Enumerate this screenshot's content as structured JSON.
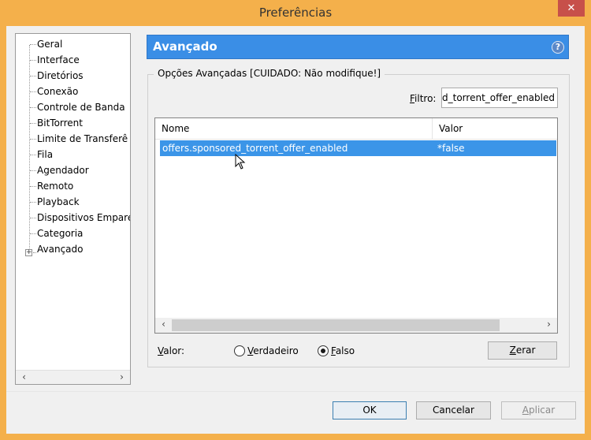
{
  "window": {
    "title": "Preferências",
    "close_symbol": "✕"
  },
  "tree": {
    "items": [
      "Geral",
      "Interface",
      "Diretórios",
      "Conexão",
      "Controle de Banda",
      "BitTorrent",
      "Limite de Transferê",
      "Fila",
      "Agendador",
      "Remoto",
      "Playback",
      "Dispositivos Empare",
      "Categoria",
      "Avançado"
    ],
    "expander_symbol": "+",
    "scroll_left": "‹",
    "scroll_right": "›"
  },
  "panel": {
    "title": "Avançado",
    "help_symbol": "?"
  },
  "group": {
    "title": "Opções Avançadas [CUIDADO: Não modifique!]"
  },
  "filter": {
    "label_prefix": "F",
    "label_rest": "iltro:",
    "value": "offers.sponsored_torrent_offer_enabled"
  },
  "list": {
    "columns": [
      "Nome",
      "Valor"
    ],
    "rows": [
      {
        "name": "offers.sponsored_torrent_offer_enabled",
        "value": "*false"
      }
    ],
    "scroll_left": "‹",
    "scroll_right": "›"
  },
  "value_editor": {
    "label_prefix": "V",
    "label_rest": "alor:",
    "options": [
      {
        "prefix": "V",
        "rest": "erdadeiro",
        "selected": false
      },
      {
        "prefix": "F",
        "rest": "also",
        "selected": true
      }
    ],
    "reset_prefix": "Z",
    "reset_rest": "erar"
  },
  "buttons": {
    "ok": "OK",
    "cancel": "Cancelar",
    "apply_prefix": "A",
    "apply_rest": "plicar"
  },
  "colors": {
    "accent": "#3b95e8",
    "window_frame": "#f4b04b",
    "close": "#c7504a"
  }
}
